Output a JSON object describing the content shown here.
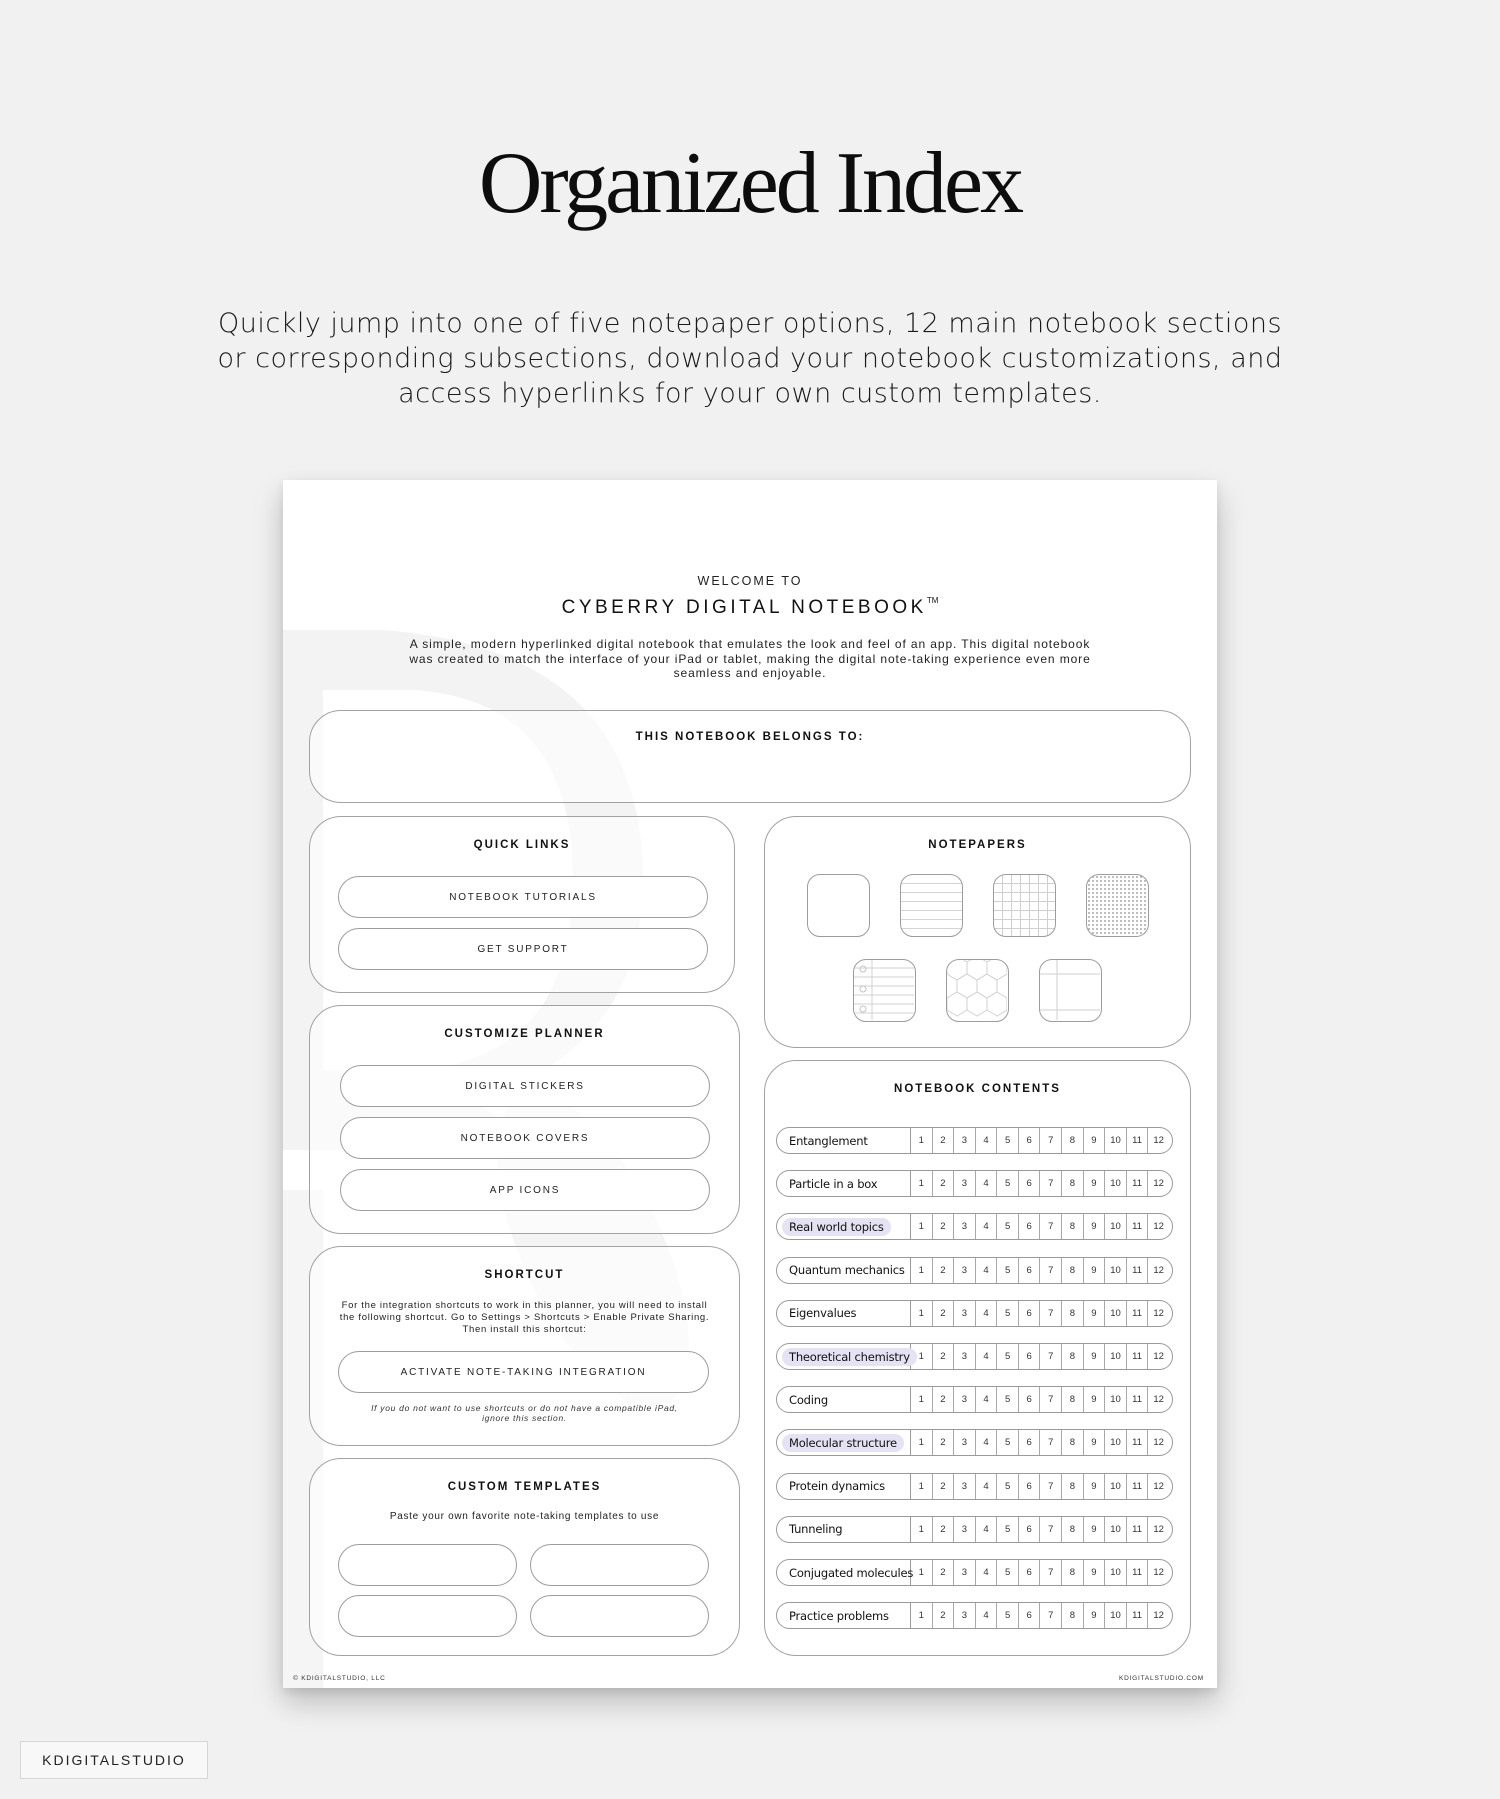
{
  "hero": {
    "title": "Organized Index",
    "subtitle": "Quickly jump into one of five notepaper options, 12 main notebook sections or corresponding subsections, download your notebook customizations, and access hyperlinks for your own custom templates."
  },
  "notebook": {
    "welcome": "WELCOME TO",
    "title": "CYBERRY DIGITAL NOTEBOOK",
    "trademark": "TM",
    "intro": "A simple, modern hyperlinked digital notebook that emulates the look and feel of an app. This digital notebook was created to match the interface of your iPad or tablet, making the digital note-taking experience even more seamless and enjoyable.",
    "belongs_to": {
      "label": "THIS NOTEBOOK BELONGS TO:",
      "value": ""
    },
    "quick_links": {
      "title": "QUICK LINKS",
      "buttons": [
        "NOTEBOOK TUTORIALS",
        "GET SUPPORT"
      ]
    },
    "customize": {
      "title": "CUSTOMIZE PLANNER",
      "buttons": [
        "DIGITAL STICKERS",
        "NOTEBOOK COVERS",
        "APP ICONS"
      ]
    },
    "shortcut": {
      "title": "SHORTCUT",
      "description": "For the integration shortcuts to work in this planner, you will need to install the following shortcut. Go to Settings > Shortcuts > Enable Private Sharing. Then install this shortcut:",
      "button": "ACTIVATE NOTE-TAKING INTEGRATION",
      "note": "If you do not want to use shortcuts or do not have a compatible iPad, ignore this section."
    },
    "custom_templates": {
      "title": "CUSTOM TEMPLATES",
      "description": "Paste your own favorite note-taking templates to use",
      "slots": [
        "",
        "",
        "",
        ""
      ]
    },
    "notepapers": {
      "title": "NOTEPAPERS",
      "options": [
        "blank",
        "lined",
        "grid",
        "dotted",
        "college-ruled",
        "hexagon",
        "cornell"
      ]
    },
    "contents": {
      "title": "NOTEBOOK CONTENTS",
      "highlight_color": "#e4e2f3",
      "subsections": [
        "1",
        "2",
        "3",
        "4",
        "5",
        "6",
        "7",
        "8",
        "9",
        "10",
        "11",
        "12"
      ],
      "sections": [
        {
          "label": "Entanglement",
          "highlighted": false
        },
        {
          "label": "Particle in a box",
          "highlighted": false
        },
        {
          "label": "Real world topics",
          "highlighted": true
        },
        {
          "label": "Quantum mechanics",
          "highlighted": false
        },
        {
          "label": "Eigenvalues",
          "highlighted": false
        },
        {
          "label": "Theoretical chemistry",
          "highlighted": true
        },
        {
          "label": "Coding",
          "highlighted": false
        },
        {
          "label": "Molecular structure",
          "highlighted": true
        },
        {
          "label": "Protein dynamics",
          "highlighted": false
        },
        {
          "label": "Tunneling",
          "highlighted": false
        },
        {
          "label": "Conjugated molecules",
          "highlighted": false
        },
        {
          "label": "Practice problems",
          "highlighted": false
        }
      ]
    },
    "footer": {
      "left": "© KDIGITALSTUDIO, LLC",
      "right": "KDIGITALSTUDIO.COM"
    }
  },
  "brand": "KDIGITALSTUDIO"
}
